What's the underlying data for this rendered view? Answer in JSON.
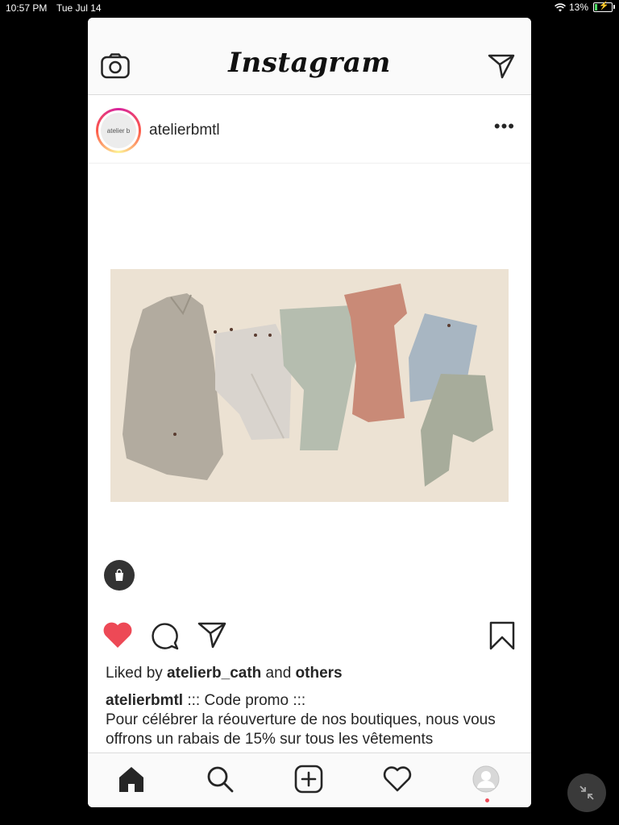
{
  "status": {
    "time": "10:57 PM",
    "date": "Tue Jul 14",
    "battery": "13%"
  },
  "header": {
    "logo": "Instagram",
    "camera_icon": "camera-icon",
    "direct_icon": "paper-plane-icon"
  },
  "post": {
    "username": "atelierbmtl",
    "avatar_text": "atelier b",
    "more_label": "•••",
    "likes": {
      "prefix": "Liked by ",
      "user": "atelierb_cath",
      "middle": " and ",
      "others": "others"
    },
    "caption": {
      "author": "atelierbmtl",
      "line1": " ::: Code promo :::",
      "line2": "Pour célébrer la réouverture de nos boutiques, nous vous offrons un rabais de 15% sur tous les vêtements"
    }
  },
  "colors": {
    "like_red": "#ed4956",
    "accent": "#262626"
  },
  "tabs": [
    "home-icon",
    "search-icon",
    "new-post-icon",
    "activity-icon",
    "profile-icon"
  ]
}
